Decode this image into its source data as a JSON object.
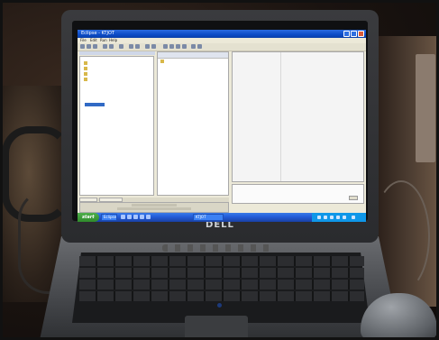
{
  "laptop": {
    "brand": "DELL"
  },
  "window": {
    "title": "Eclipse - KTJOT",
    "menu": [
      "File",
      "Edit",
      "Run",
      "Help"
    ]
  },
  "taskbar": {
    "start_label": "start",
    "buttons": [
      "Eclipse",
      "KTJOT"
    ]
  }
}
